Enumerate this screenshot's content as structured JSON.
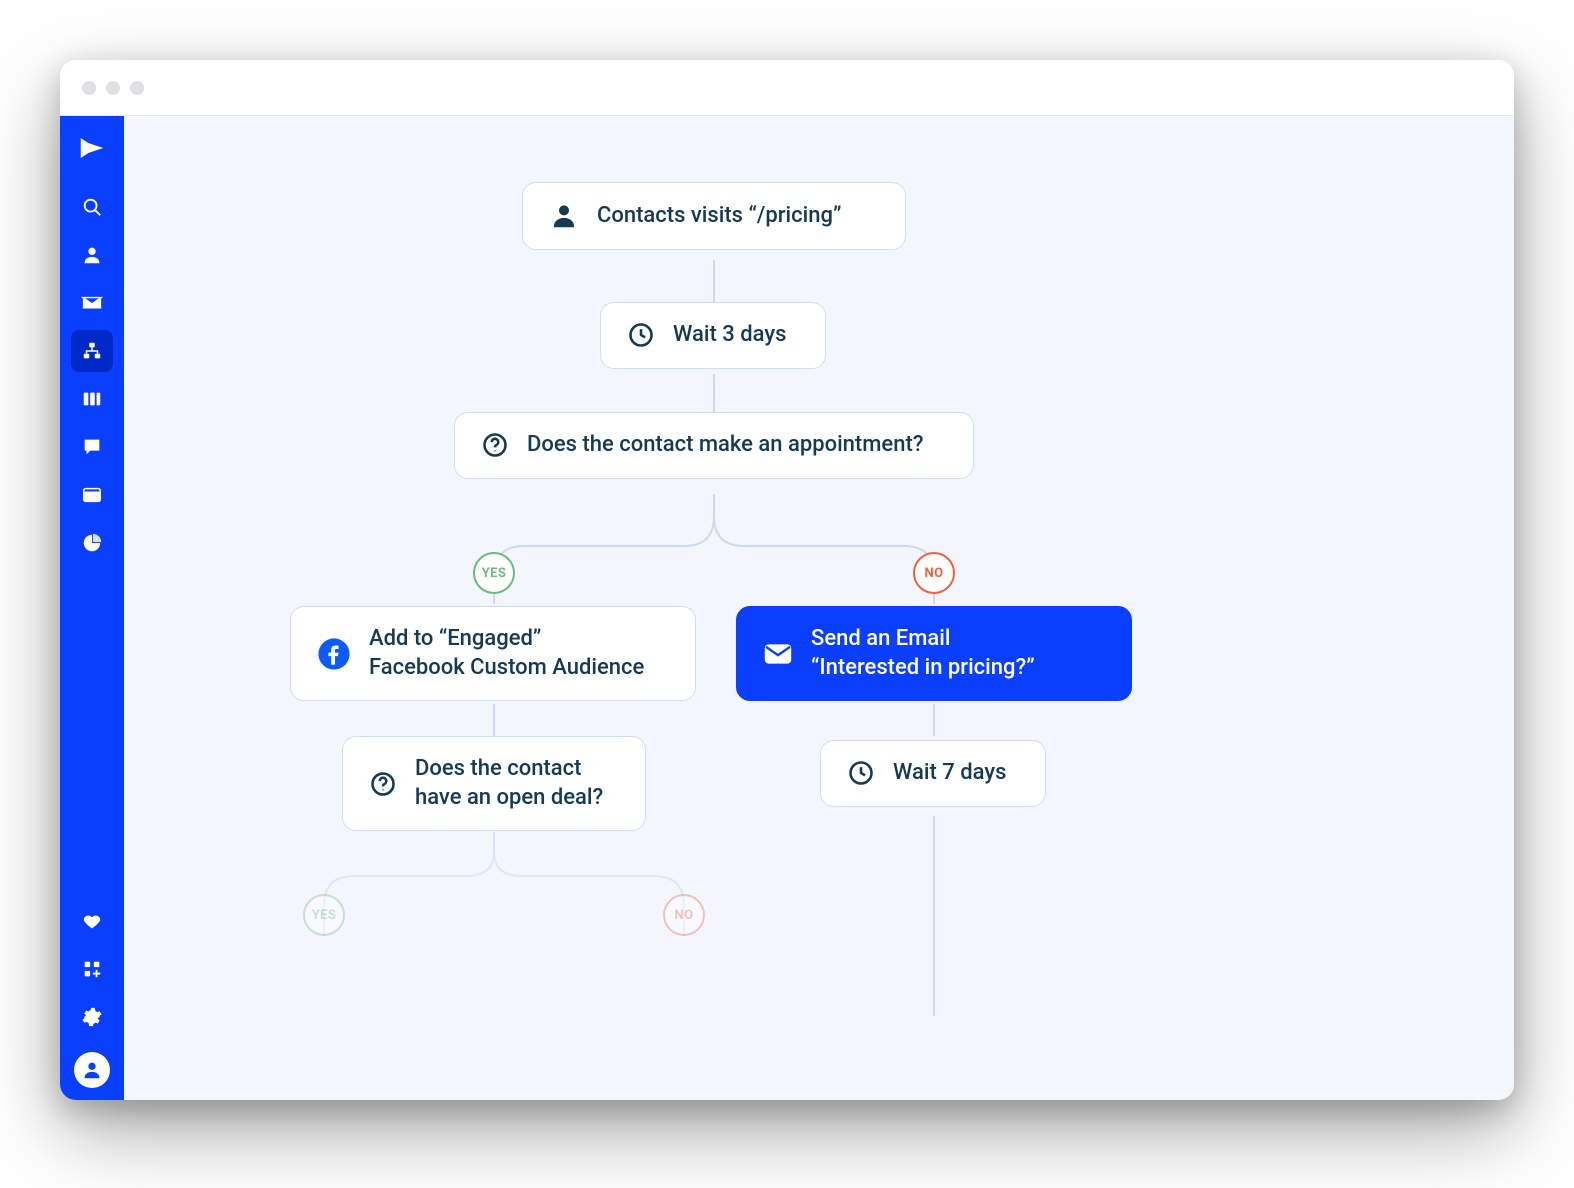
{
  "flow": {
    "trigger": {
      "label": "Contacts visits “/pricing”"
    },
    "wait1": {
      "label": "Wait 3 days"
    },
    "cond1": {
      "label": "Does the contact make an appointment?"
    },
    "branch_yes": "YES",
    "branch_no": "NO",
    "yes_action": {
      "label": "Add to “Engaged”\nFacebook Custom Audience"
    },
    "no_action": {
      "label": "Send an Email\n“Interested in pricing?”"
    },
    "cond2": {
      "label": "Does the contact\nhave an open deal?"
    },
    "wait2": {
      "label": "Wait 7 days"
    },
    "branch2_yes": "YES",
    "branch2_no": "NO"
  },
  "sidebar": {
    "items": [
      {
        "name": "search"
      },
      {
        "name": "contacts"
      },
      {
        "name": "campaigns"
      },
      {
        "name": "automations",
        "active": true
      },
      {
        "name": "deals"
      },
      {
        "name": "conversations"
      },
      {
        "name": "site"
      },
      {
        "name": "reports"
      }
    ],
    "bottom": [
      {
        "name": "favorites"
      },
      {
        "name": "apps"
      },
      {
        "name": "settings"
      },
      {
        "name": "account"
      }
    ]
  }
}
